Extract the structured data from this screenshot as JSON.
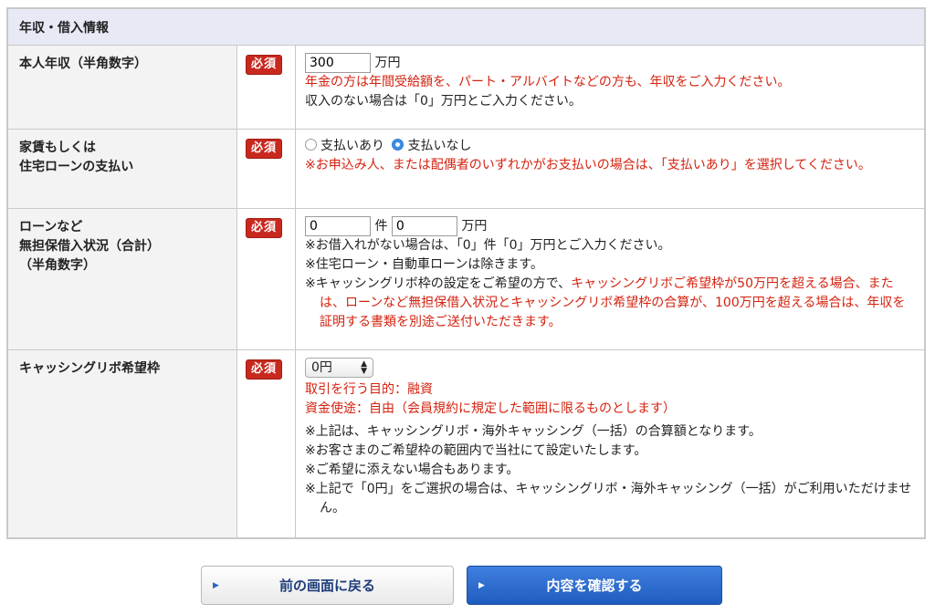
{
  "section": {
    "title": "年収・借入情報"
  },
  "required_label": "必須",
  "annual_income": {
    "label": "本人年収（半角数字）",
    "value": "300",
    "unit": "万円",
    "note_red": "年金の方は年間受給額を、パート・アルバイトなどの方も、年収をご入力ください。",
    "note": "収入のない場合は「0」万円とご入力ください。"
  },
  "rent": {
    "label": "家賃もしくは\n住宅ローンの支払い",
    "option_yes": "支払いあり",
    "option_no": "支払いなし",
    "selected": "支払いなし",
    "note_red": "※お申込み人、または配偶者のいずれかがお支払いの場合は、「支払いあり」を選択してください。"
  },
  "loans": {
    "label": "ローンなど\n無担保借入状況（合計）\n（半角数字）",
    "count_value": "0",
    "count_unit": "件",
    "amount_value": "0",
    "amount_unit": "万円",
    "note1": "※お借入れがない場合は、「0」件「0」万円とご入力ください。",
    "note2": "※住宅ローン・自動車ローンは除きます。",
    "note3_prefix": "※キャッシングリボ枠の設定をご希望の方で、",
    "note3_red": "キャッシングリボご希望枠が50万円を超える場合、または、ローンなど無担保借入状況とキャッシングリボ希望枠の合算が、100万円を超える場合は、年収を証明する書類を別途ご送付いただきます。"
  },
  "cashing": {
    "label": "キャッシングリボ希望枠",
    "select_value": "0円",
    "purpose": "取引を行う目的：融資",
    "usage": "資金使途：自由（会員規約に規定した範囲に限るものとします）",
    "note1": "※上記は、キャッシングリボ・海外キャッシング（一括）の合算額となります。",
    "note2": "※お客さまのご希望枠の範囲内で当社にて設定いたします。",
    "note3": "※ご希望に添えない場合もあります。",
    "note4": "※上記で「0円」をご選択の場合は、キャッシングリボ・海外キャッシング（一括）がご利用いただけません。"
  },
  "buttons": {
    "back": "前の画面に戻る",
    "confirm": "内容を確認する"
  },
  "colors": {
    "required_badge": "#c8281e",
    "note_red": "#d4220f",
    "header_bg": "#e7eaf5",
    "confirm_button": "#2a6bd0"
  }
}
